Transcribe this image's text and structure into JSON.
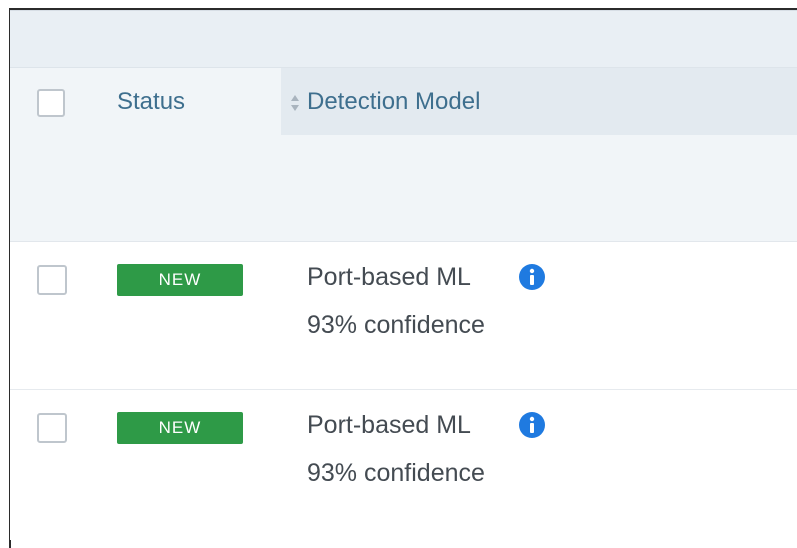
{
  "table": {
    "header": {
      "status_label": "Status",
      "model_label": "Detection Model",
      "sort_icon": "sort-up-down-icon"
    },
    "rows": [
      {
        "status": "NEW",
        "status_color": "#2e9a47",
        "model": "Port-based ML",
        "info_icon": "info-circle-icon",
        "confidence": "93% confidence"
      },
      {
        "status": "NEW",
        "status_color": "#2e9a47",
        "model": "Port-based ML",
        "info_icon": "info-circle-icon",
        "confidence": "93% confidence"
      }
    ]
  },
  "colors": {
    "header_text": "#3e6f8e",
    "info_icon": "#1f7ae0",
    "body_text": "#444b52"
  }
}
